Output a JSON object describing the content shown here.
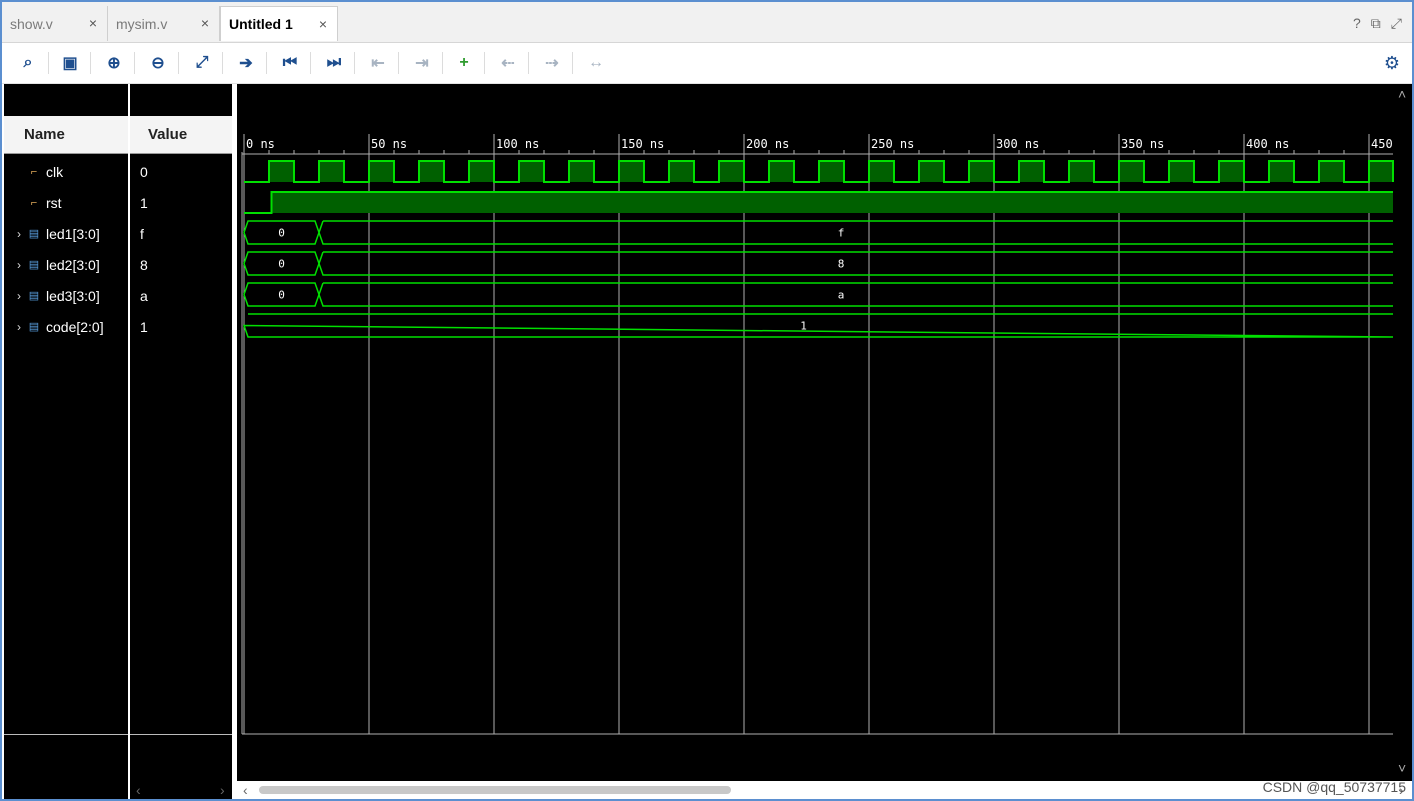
{
  "tabs": [
    {
      "label": "show.v",
      "close": "×"
    },
    {
      "label": "mysim.v",
      "close": "×"
    },
    {
      "label": "Untitled 1",
      "close": "×"
    }
  ],
  "window_icons": [
    "?",
    "⧉",
    "⤢"
  ],
  "toolbar": [
    {
      "icon": "search-icon",
      "glyph": "⌕"
    },
    {
      "icon": "save-icon",
      "glyph": "▣"
    },
    {
      "icon": "zoom-in-icon",
      "glyph": "⊕"
    },
    {
      "icon": "zoom-out-icon",
      "glyph": "⊖"
    },
    {
      "icon": "zoom-fit-icon",
      "glyph": "⤢"
    },
    {
      "icon": "go-to-cursor-icon",
      "glyph": "➔"
    },
    {
      "icon": "go-to-time-zero-icon",
      "glyph": "⏮"
    },
    {
      "icon": "go-to-last-time-icon",
      "glyph": "⏭"
    },
    {
      "icon": "previous-transition-icon",
      "glyph": "⇤"
    },
    {
      "icon": "next-transition-icon",
      "glyph": "⇥"
    },
    {
      "icon": "add-marker-icon",
      "glyph": "+"
    },
    {
      "icon": "previous-marker-icon",
      "glyph": "⇠"
    },
    {
      "icon": "next-marker-icon",
      "glyph": "⇢"
    },
    {
      "icon": "swap-cursors-icon",
      "glyph": "↔"
    }
  ],
  "columns": {
    "name": "Name",
    "value": "Value"
  },
  "signals": [
    {
      "name": "clk",
      "value": "0",
      "kind": "bit",
      "expandable": false
    },
    {
      "name": "rst",
      "value": "1",
      "kind": "bit",
      "expandable": false
    },
    {
      "name": "led1[3:0]",
      "value": "f",
      "kind": "bus",
      "expandable": true
    },
    {
      "name": "led2[3:0]",
      "value": "8",
      "kind": "bus",
      "expandable": true
    },
    {
      "name": "led3[3:0]",
      "value": "a",
      "kind": "bus",
      "expandable": true
    },
    {
      "name": "code[2:0]",
      "value": "1",
      "kind": "bus",
      "expandable": true
    }
  ],
  "waveform": {
    "time_unit": "ns",
    "ticks": [
      "0 ns",
      "50 ns",
      "100 ns",
      "150 ns",
      "200 ns",
      "250 ns",
      "300 ns",
      "350 ns",
      "400 ns",
      "450"
    ],
    "tick_values": [
      0,
      50,
      100,
      150,
      200,
      250,
      300,
      350,
      400,
      450
    ],
    "time_range": [
      0,
      460
    ],
    "clk": {
      "period": 20,
      "first_rise": 10,
      "initial": 0
    },
    "rst": {
      "initial": 0,
      "rise": 11
    },
    "buses": [
      {
        "signal": "led1[3:0]",
        "segments": [
          {
            "t0": 0,
            "t1": 30,
            "label": "0"
          },
          {
            "t0": 30,
            "t1": 460,
            "label": "f"
          }
        ]
      },
      {
        "signal": "led2[3:0]",
        "segments": [
          {
            "t0": 0,
            "t1": 30,
            "label": "0"
          },
          {
            "t0": 30,
            "t1": 460,
            "label": "8"
          }
        ]
      },
      {
        "signal": "led3[3:0]",
        "segments": [
          {
            "t0": 0,
            "t1": 30,
            "label": "0"
          },
          {
            "t0": 30,
            "t1": 460,
            "label": "a"
          }
        ]
      },
      {
        "signal": "code[2:0]",
        "segments": [
          {
            "t0": 0,
            "t1": 460,
            "label": "1"
          }
        ]
      }
    ],
    "colors": {
      "trace": "#00e000",
      "fill": "#006000",
      "grid": "#b0b0b0",
      "ruler_text": "#ffffff",
      "background": "#000000"
    }
  },
  "settings_icon": "gear-icon",
  "watermark": "CSDN @qq_50737715"
}
